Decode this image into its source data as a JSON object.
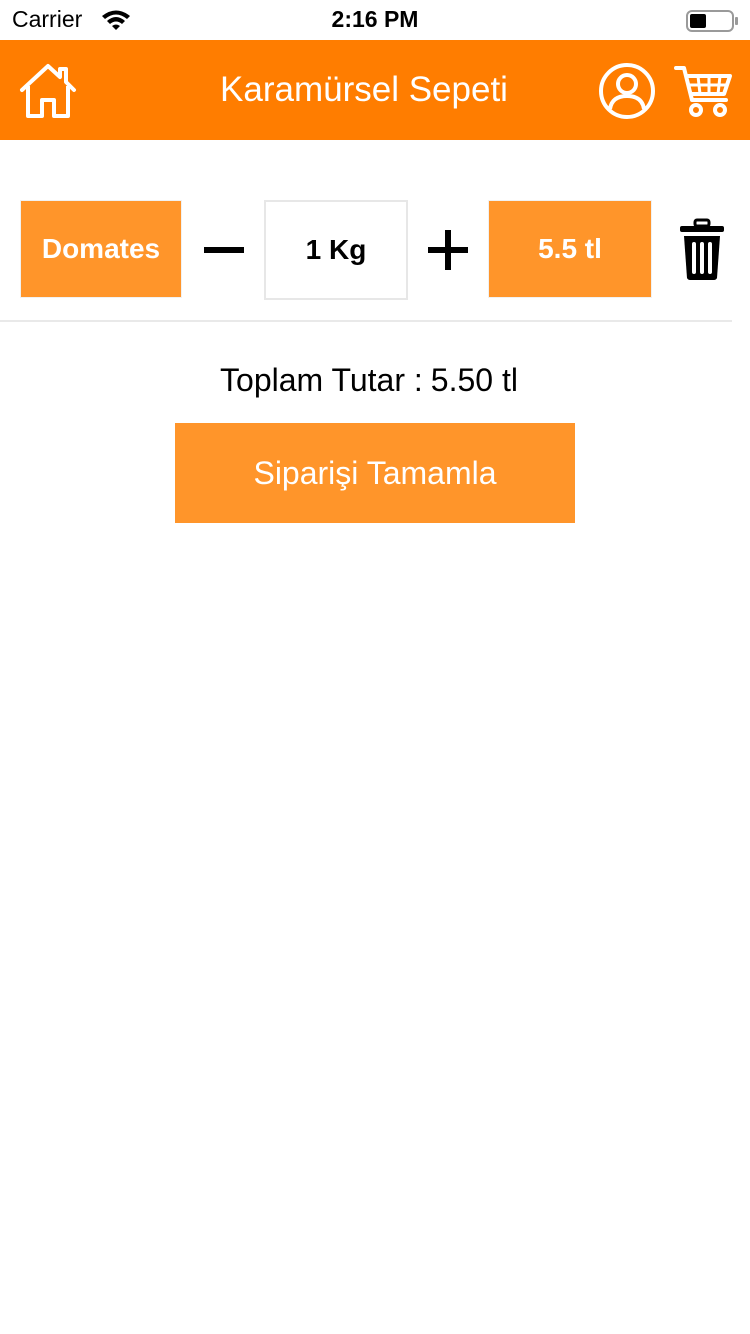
{
  "status_bar": {
    "carrier": "Carrier",
    "time": "2:16 PM",
    "wifi_icon": "wifi-icon",
    "battery_icon": "battery-icon"
  },
  "header": {
    "title": "Karamürsel Sepeti",
    "home_icon": "home-icon",
    "profile_icon": "user-icon",
    "cart_icon": "cart-icon"
  },
  "cart": {
    "items": [
      {
        "name": "Domates",
        "quantity": "1 Kg",
        "price": "5.5 tl",
        "minus_icon": "minus-icon",
        "plus_icon": "plus-icon",
        "delete_icon": "trash-icon"
      }
    ]
  },
  "summary": {
    "total_label": "Toplam Tutar :",
    "total_value": "5.50 tl",
    "complete_label": "Siparişi Tamamla"
  },
  "colors": {
    "header_bg": "#ff7d00",
    "accent": "#ff952a",
    "text_dark": "#000000",
    "divider": "#e9e9e9"
  }
}
